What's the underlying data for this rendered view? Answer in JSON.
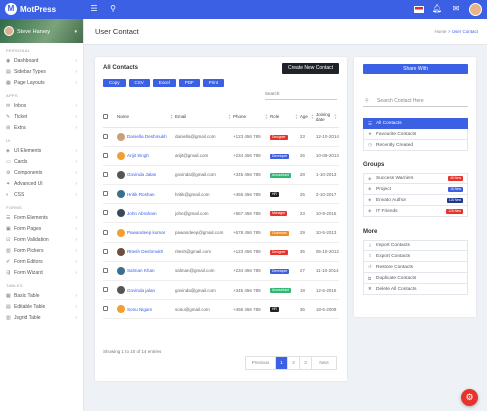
{
  "app": {
    "name": "MotPress"
  },
  "profile": {
    "name": "Steve Harvey"
  },
  "sidebar": {
    "sections": [
      {
        "title": "PERSONAL",
        "items": [
          "Dashboard",
          "Sidebar Types",
          "Page Layouts"
        ]
      },
      {
        "title": "APPS",
        "items": [
          "Inbox",
          "Ticket",
          "Extra"
        ]
      },
      {
        "title": "UI",
        "items": [
          "UI Elements",
          "Cards",
          "Components",
          "Advanced UI",
          "CSS"
        ]
      },
      {
        "title": "FORMS",
        "items": [
          "Form Elements",
          "Form Pages",
          "Form Validation",
          "Form Pickers",
          "Form Editors",
          "Form Wizard"
        ]
      },
      {
        "title": "TABLES",
        "items": [
          "Basic Table",
          "Editable Table",
          "Jsgrid Table"
        ]
      }
    ]
  },
  "header": {
    "title": "User Contact",
    "crumb_home": "Home",
    "crumb_sep": ">",
    "crumb_current": "User Contact"
  },
  "contacts": {
    "title": "All Contacts",
    "new_button": "Create New Contact",
    "export_buttons": [
      "Copy",
      "CSV",
      "Excel",
      "PDF",
      "Print"
    ],
    "search_label": "Search:",
    "columns": [
      "Name",
      "Email",
      "Phone",
      "Role",
      "Age",
      "Joining date"
    ],
    "rows": [
      {
        "name": "Daniella Deshmukh",
        "email": "daniella@gmail.com",
        "phone": "+123 456 789",
        "role": "Designer",
        "role_color": "#e8332b",
        "age": "23",
        "date": "12-10-2014",
        "avatar": "#c9a07e"
      },
      {
        "name": "Arijit Singh",
        "email": "arijit@gmail.com",
        "phone": "+234 456 789",
        "role": "Developer",
        "role_color": "#3b60e4",
        "age": "26",
        "date": "10-09-2014",
        "avatar": "#f0a030"
      },
      {
        "name": "Govinda Jalan",
        "email": "govinda@gmail.com",
        "phone": "+345 456 789",
        "role": "Accountant",
        "role_color": "#2eb872",
        "age": "28",
        "date": "1-10-2013",
        "avatar": "#555555"
      },
      {
        "name": "Hritik Roshan",
        "email": "hritik@gmail.com",
        "phone": "+456 456 789",
        "role": "HR",
        "role_color": "#222222",
        "age": "25",
        "date": "2-10-2017",
        "avatar": "#3c6e8f"
      },
      {
        "name": "John Abraham",
        "email": "john@gmail.com",
        "phone": "+567 456 789",
        "role": "Manager",
        "role_color": "#e8332b",
        "age": "23",
        "date": "10-9-2015",
        "avatar": "#3a4a5c"
      },
      {
        "name": "Pawandeep kumar",
        "email": "pawandeep@gmail.com",
        "phone": "+678 456 789",
        "role": "Chairman",
        "role_color": "#f08a24",
        "age": "29",
        "date": "10-5-2013",
        "avatar": "#f0a030"
      },
      {
        "name": "Ritesh Deshmukh",
        "email": "ritesh@gmail.com",
        "phone": "+123 456 789",
        "role": "Designer",
        "role_color": "#e8332b",
        "age": "35",
        "date": "05-10-2012",
        "avatar": "#6b5040"
      },
      {
        "name": "Salman Khan",
        "email": "salman@gmail.com",
        "phone": "+234 456 789",
        "role": "Developer",
        "role_color": "#3b60e4",
        "age": "27",
        "date": "11-10-2014",
        "avatar": "#3c6e8f"
      },
      {
        "name": "Govinda jalan",
        "email": "govinda@gmail.com",
        "phone": "+345 456 789",
        "role": "Accountant",
        "role_color": "#2eb872",
        "age": "18",
        "date": "12-5-2016",
        "avatar": "#555555"
      },
      {
        "name": "Sonu Nigam",
        "email": "sonu@gmail.com",
        "phone": "+456 456 789",
        "role": "HR",
        "role_color": "#222222",
        "age": "36",
        "date": "18-5-2009",
        "avatar": "#f0a030"
      }
    ],
    "info": "Showing 1 to 10 of 14 entries",
    "pager": [
      "Previous",
      "1",
      "2",
      "3",
      "Next"
    ],
    "current_page": "1"
  },
  "panel": {
    "share_button": "Share With",
    "search_placeholder": "Search Contact Here",
    "views": [
      {
        "label": "All Contacts",
        "icon": "list-icon",
        "active": true
      },
      {
        "label": "Favourite Contacts",
        "icon": "star-icon",
        "active": false
      },
      {
        "label": "Recently Created",
        "icon": "clock-icon",
        "active": false
      }
    ],
    "groups_title": "Groups",
    "groups": [
      {
        "label": "Success Warriers",
        "badge": "46 New",
        "color": "#e8332b"
      },
      {
        "label": "Project",
        "badge": "16 New",
        "color": "#3b60e4"
      },
      {
        "label": "Envato Author",
        "badge": "116 New",
        "color": "#1f3a8a"
      },
      {
        "label": "IT Friends",
        "badge": "126 New",
        "color": "#e8332b"
      }
    ],
    "more_title": "More",
    "more": [
      "Import Contacts",
      "Export Contacts",
      "Restore Contacts",
      "Duplicate Contacts",
      "Delete All Contacts"
    ]
  },
  "colors": {
    "primary": "#3b60e4",
    "danger": "#e8332b",
    "dark": "#1f2329"
  }
}
